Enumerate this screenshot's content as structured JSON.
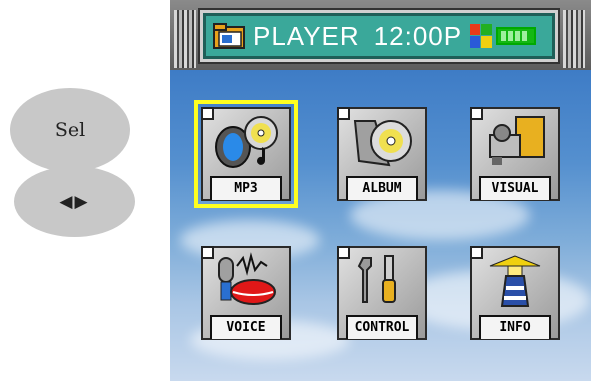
{
  "controls": {
    "select_label": "Sel",
    "nav_label": "◀▶"
  },
  "titlebar": {
    "title": "PLAYER",
    "time": "12:00P",
    "folder_icon": "folder-icon",
    "battery_icon": "battery-icon",
    "battery_level": "full"
  },
  "menu": {
    "selected": "MP3",
    "items": [
      {
        "label": "MP3",
        "icon": "mp3-icon"
      },
      {
        "label": "ALBUM",
        "icon": "album-icon"
      },
      {
        "label": "VISUAL",
        "icon": "visual-icon"
      },
      {
        "label": "VOICE",
        "icon": "voice-icon"
      },
      {
        "label": "CONTROL",
        "icon": "control-icon"
      },
      {
        "label": "INFO",
        "icon": "info-icon"
      }
    ]
  },
  "colors": {
    "selection": "#ffff20",
    "titlebar": "#3aa89a",
    "background_sky": "#4f8acb"
  }
}
